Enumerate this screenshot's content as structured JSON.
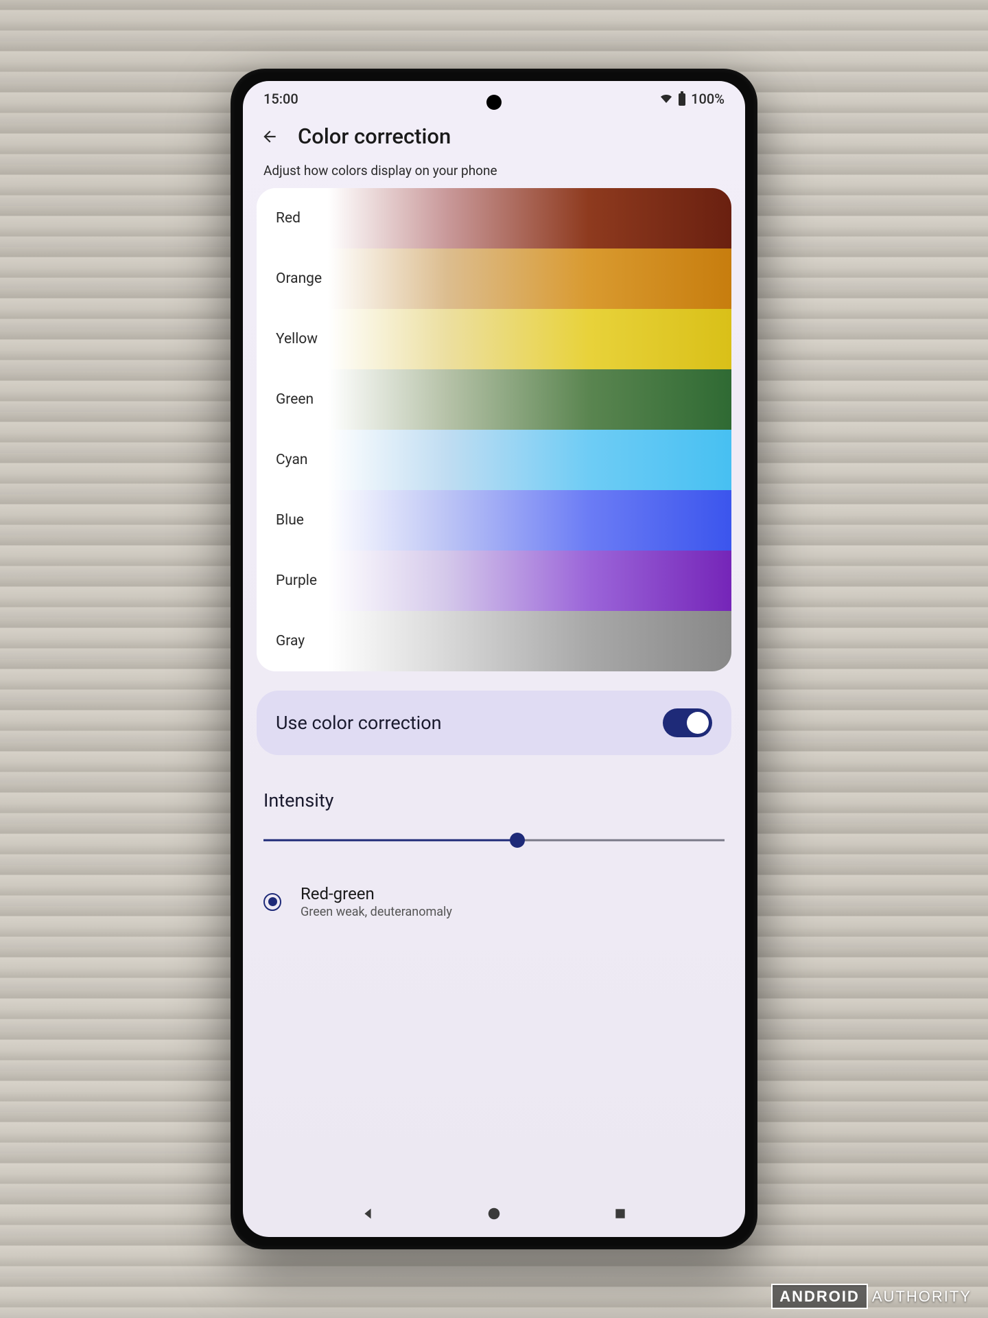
{
  "status_bar": {
    "time": "15:00",
    "battery_text": "100%"
  },
  "header": {
    "title": "Color correction"
  },
  "subtitle": "Adjust how colors display on your phone",
  "color_rows": [
    {
      "label": "Red"
    },
    {
      "label": "Orange"
    },
    {
      "label": "Yellow"
    },
    {
      "label": "Green"
    },
    {
      "label": "Cyan"
    },
    {
      "label": "Blue"
    },
    {
      "label": "Purple"
    },
    {
      "label": "Gray"
    }
  ],
  "toggle": {
    "label": "Use color correction",
    "on": true
  },
  "intensity": {
    "label": "Intensity",
    "value_percent": 55
  },
  "correction_option": {
    "title": "Red-green",
    "subtitle": "Green weak, deuteranomaly",
    "selected": true
  },
  "watermark": {
    "brand": "ANDROID",
    "sub": "AUTHORITY"
  }
}
